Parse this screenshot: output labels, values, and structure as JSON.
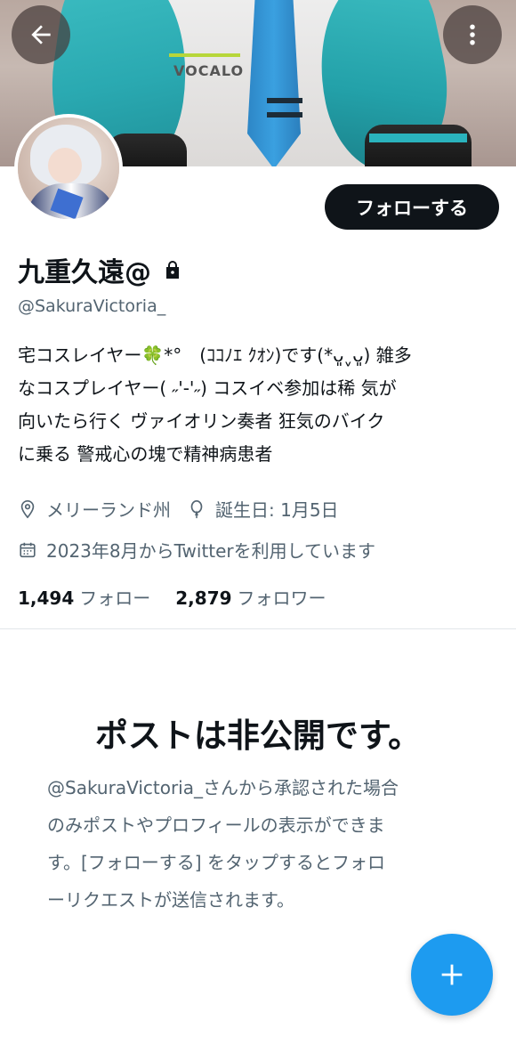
{
  "header": {
    "back_icon": "arrow-left-icon",
    "more_icon": "more-vertical-icon",
    "banner_text": "VOCALO"
  },
  "profile": {
    "follow_button_label": "フォローする",
    "display_name": "九重久遠@",
    "lock_icon": "lock-icon",
    "handle": "@SakuraVictoria_",
    "bio": "宅コスレイヤー🍀*°　(ｺｺﾉｴ ｸｵﾝ)です(*ᴗ͈ˬᴗ͈) 雑多\nなコスプレイヤー( ˶'-'˶) コスイベ参加は稀 気が\n向いたら行く ヴァイオリン奏者 狂気のバイク\nに乗る 警戒心の塊で精神病患者",
    "location": "メリーランド州",
    "birthday": "誕生日: 1月5日",
    "joined": "2023年8月からTwitterを利用しています",
    "following_count": "1,494",
    "following_label": "フォロー",
    "followers_count": "2,879",
    "followers_label": "フォロワー"
  },
  "private_notice": {
    "title": "ポストは非公開です。",
    "body": "@SakuraVictoria_さんから承認された場合\nのみポストやプロフィールの表示ができま\nす。[フォローする] をタップするとフォロ\nーリクエストが送信されます。"
  },
  "fab": {
    "icon": "plus-icon"
  },
  "colors": {
    "accent": "#1d9bf0",
    "text_primary": "#0f1419",
    "text_secondary": "#536471",
    "button_dark": "#0f1419"
  }
}
